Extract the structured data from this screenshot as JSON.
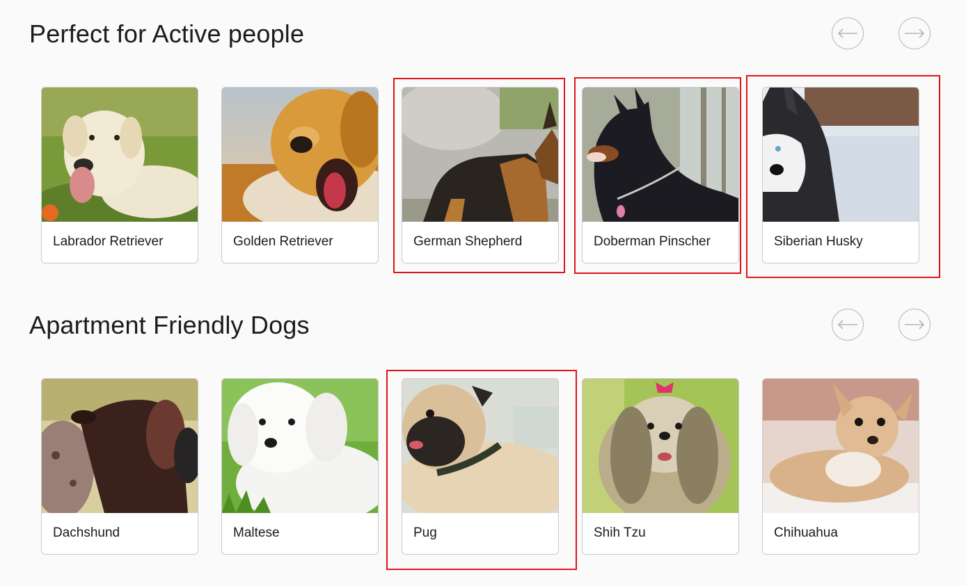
{
  "sections": [
    {
      "title": "Perfect for Active people",
      "cards": [
        {
          "label": "Labrador Retriever"
        },
        {
          "label": "Golden Retriever"
        },
        {
          "label": "German Shepherd"
        },
        {
          "label": "Doberman Pinscher"
        },
        {
          "label": "Siberian Husky"
        }
      ]
    },
    {
      "title": "Apartment Friendly Dogs",
      "cards": [
        {
          "label": "Dachshund"
        },
        {
          "label": "Maltese"
        },
        {
          "label": "Pug"
        },
        {
          "label": "Shih Tzu"
        },
        {
          "label": "Chihuahua"
        }
      ]
    }
  ],
  "icons": {
    "prev": "arrow-left-icon",
    "next": "arrow-right-icon"
  },
  "colors": {
    "highlight": "#e0141b",
    "background": "#fafafa",
    "card_border": "#c9c9c9"
  }
}
